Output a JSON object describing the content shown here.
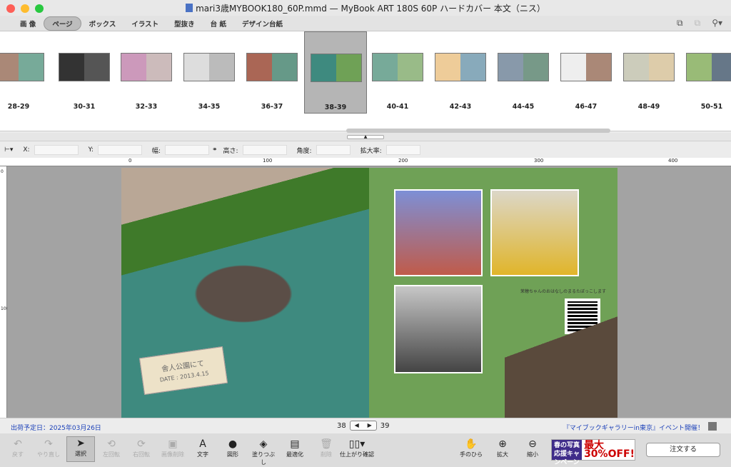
{
  "window": {
    "title": "mari3歳MYBOOK180_60P.mmd — MyBook ART 180S 60P ハードカバー 本文（ニス）"
  },
  "tabs": [
    {
      "label": "画 像"
    },
    {
      "label": "ページ"
    },
    {
      "label": "ボックス"
    },
    {
      "label": "イラスト"
    },
    {
      "label": "型抜き"
    },
    {
      "label": "台 紙"
    },
    {
      "label": "デザイン台紙"
    }
  ],
  "thumbnails": [
    {
      "label": "28-29"
    },
    {
      "label": "30-31"
    },
    {
      "label": "32-33"
    },
    {
      "label": "34-35"
    },
    {
      "label": "36-37"
    },
    {
      "label": "38-39"
    },
    {
      "label": "40-41"
    },
    {
      "label": "42-43"
    },
    {
      "label": "44-45"
    },
    {
      "label": "46-47"
    },
    {
      "label": "48-49"
    },
    {
      "label": "50-51"
    }
  ],
  "fields": {
    "x": "X:",
    "y": "Y:",
    "width": "幅:",
    "height": "高さ:",
    "angle": "角度:",
    "zoom": "拡大率:"
  },
  "ruler": {
    "h": [
      "0",
      "100",
      "200",
      "300",
      "400"
    ],
    "v": [
      "0",
      "100"
    ]
  },
  "spread": {
    "tag_title": "舎人公園にて",
    "tag_date": "DATE : 2013.4.15",
    "caption": "茉穂ちゃんのおはなしのまるたぼっこします"
  },
  "status": {
    "ship_date": "出荷予定日：2025年03月26日",
    "page_left": "38",
    "page_right": "39",
    "news": "『マイブックギャラリーin東京』イベント開催！"
  },
  "toolbar": {
    "undo": "戻す",
    "redo": "やり直し",
    "select": "選択",
    "rotate_l": "左回転",
    "rotate_r": "右回転",
    "delete_img": "画像削除",
    "text": "文字",
    "shape": "図形",
    "fill": "塗りつぶし",
    "optimize": "最適化",
    "trash": "削除",
    "finish": "仕上がり確認",
    "hand": "手のひら",
    "zoom_in": "拡大",
    "zoom_out": "縮小",
    "order": "注文する"
  },
  "promo": {
    "left": "春の写真応援キャンペーン",
    "right": "最大30%OFF!"
  }
}
